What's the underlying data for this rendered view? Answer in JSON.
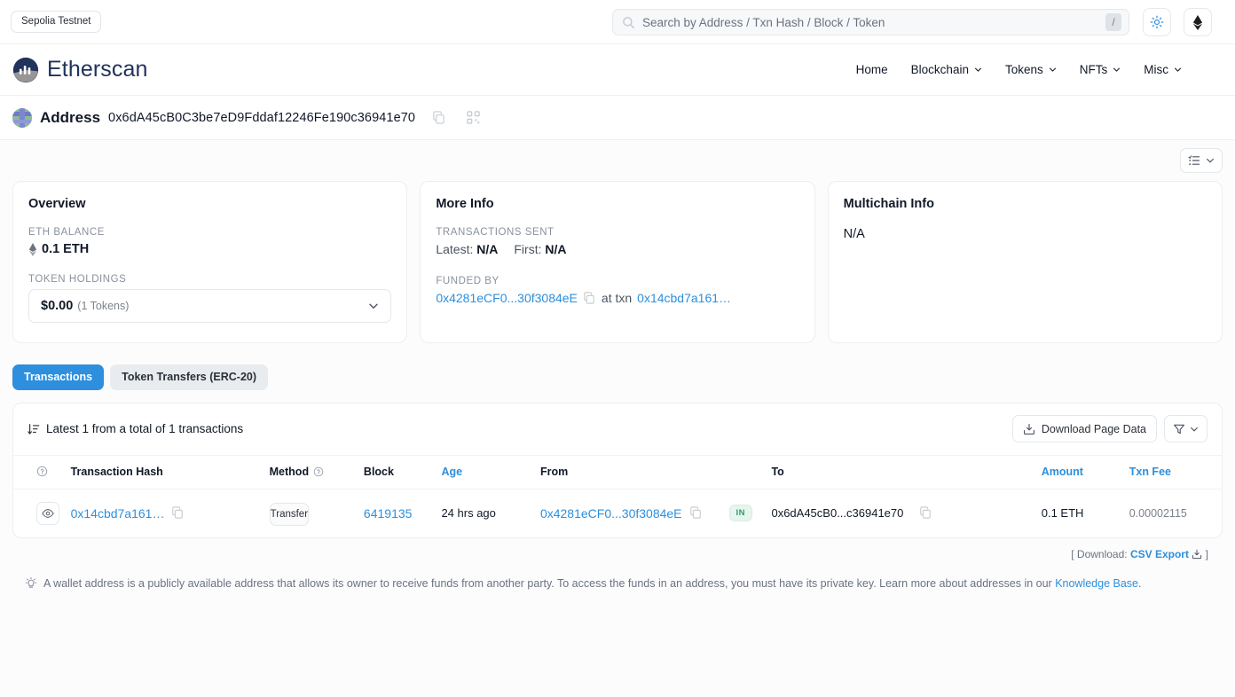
{
  "topbar": {
    "network_label": "Sepolia Testnet",
    "search": {
      "placeholder": "Search by Address / Txn Hash / Block / Token",
      "value": "",
      "shortcut": "/"
    },
    "theme_icon": "sun-icon",
    "chain_icon": "ethereum-icon"
  },
  "brand": {
    "name": "Etherscan",
    "logo_icon": "etherscan-logo-icon"
  },
  "nav": {
    "items": [
      {
        "label": "Home",
        "has_caret": false
      },
      {
        "label": "Blockchain",
        "has_caret": true
      },
      {
        "label": "Tokens",
        "has_caret": true
      },
      {
        "label": "NFTs",
        "has_caret": true
      },
      {
        "label": "Misc",
        "has_caret": true
      }
    ]
  },
  "address_header": {
    "title": "Address",
    "hash": "0x6dA45cB0C3be7eD9Fddaf12246Fe190c36941e70",
    "copy_icon": "copy-icon",
    "qr_icon": "qr-code-icon",
    "avatar_icon": "identicon-avatar"
  },
  "toolbar": {
    "listview_icon": "list-view-icon",
    "listview_caret_icon": "chevron-down-icon"
  },
  "overview": {
    "title": "Overview",
    "eth_balance_label": "ETH BALANCE",
    "eth_balance_value": "0.1 ETH",
    "token_holdings_label": "TOKEN HOLDINGS",
    "token_value": "$0.00",
    "token_count": "(1 Tokens)"
  },
  "more_info": {
    "title": "More Info",
    "transactions_sent_label": "TRANSACTIONS SENT",
    "latest_label": "Latest:",
    "latest_value": "N/A",
    "first_label": "First:",
    "first_value": "N/A",
    "funded_by_label": "FUNDED BY",
    "funded_address": "0x4281eCF0...30f3084eE",
    "at_txn_label": "at txn",
    "funded_txn": "0x14cbd7a161…"
  },
  "multichain": {
    "title": "Multichain Info",
    "value": "N/A"
  },
  "tabs": [
    {
      "label": "Transactions",
      "active": true
    },
    {
      "label": "Token Transfers (ERC-20)",
      "active": false
    }
  ],
  "txpanel": {
    "latest_text": "Latest 1 from a total of 1 transactions",
    "sort_icon": "sort-descending-icon",
    "download_label": "Download Page Data",
    "download_icon": "download-icon",
    "filter_icon": "funnel-icon",
    "columns": [
      {
        "label": "",
        "sortable": false,
        "info": true
      },
      {
        "label": "Transaction Hash",
        "sortable": false
      },
      {
        "label": "Method",
        "sortable": false,
        "info": true
      },
      {
        "label": "Block",
        "sortable": false
      },
      {
        "label": "Age",
        "sortable": true
      },
      {
        "label": "From",
        "sortable": false
      },
      {
        "label": "To",
        "sortable": false
      },
      {
        "label": "Amount",
        "sortable": true
      },
      {
        "label": "Txn Fee",
        "sortable": true
      }
    ],
    "rows": [
      {
        "hash": "0x14cbd7a161…",
        "method": "Transfer",
        "block": "6419135",
        "age": "24 hrs ago",
        "from": "0x4281eCF0...30f3084eE",
        "direction": "IN",
        "to": "0x6dA45cB0...c36941e70",
        "amount": "0.1 ETH",
        "fee": "0.00002115"
      }
    ]
  },
  "download_row": {
    "open_bracket": "[",
    "prefix": "Download:",
    "link": "CSV Export",
    "close_bracket": "]",
    "icon": "download-icon"
  },
  "disclaimer": {
    "icon": "lightbulb-icon",
    "text": "A wallet address is a publicly available address that allows its owner to receive funds from another party. To access the funds in an address, you must have its private key. Learn more about addresses in our ",
    "link": "Knowledge Base",
    "period": "."
  },
  "colors": {
    "accent_blue": "#2d8fdd",
    "brand_navy": "#21325b",
    "badge_green": "#2f9e6e"
  }
}
